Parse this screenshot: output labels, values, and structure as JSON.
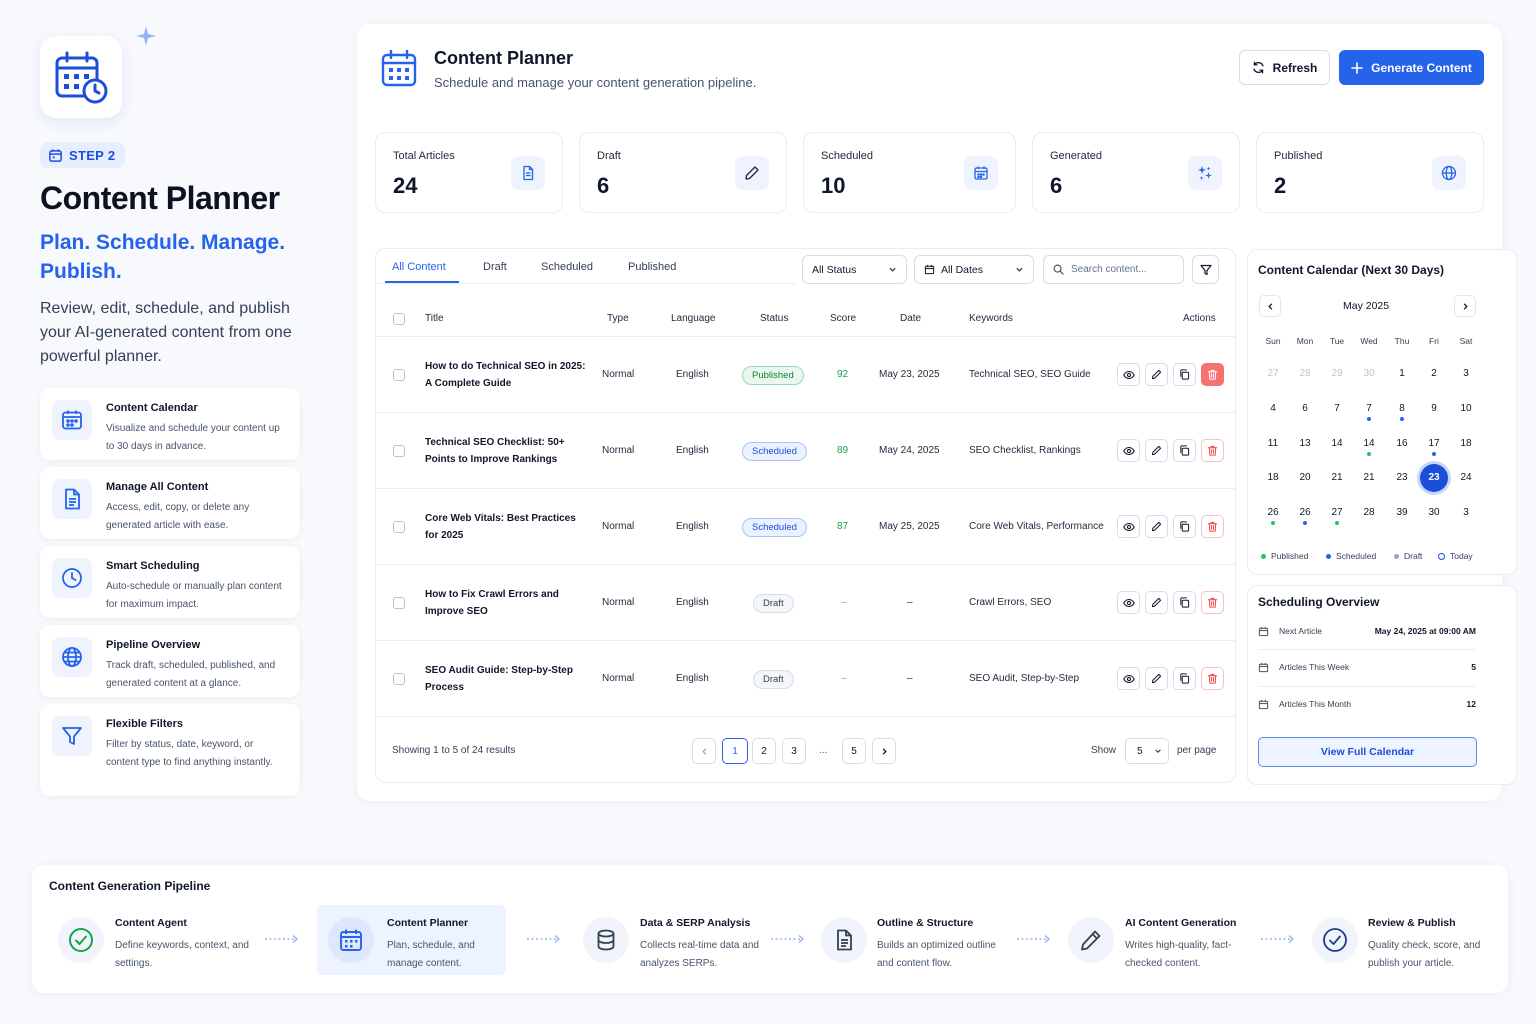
{
  "hero": {
    "step": "STEP 2",
    "title": "Content Planner",
    "tagline": "Plan. Schedule. Manage. Publish.",
    "description": "Review, edit, schedule, and publish your AI-generated content from one powerful planner."
  },
  "features": [
    {
      "title": "Content Calendar",
      "desc": "Visualize and schedule your content up to 30 days in advance.",
      "icon": "calendar-icon"
    },
    {
      "title": "Manage All Content",
      "desc": "Access, edit, copy, or delete any generated article with ease.",
      "icon": "document-icon"
    },
    {
      "title": "Smart Scheduling",
      "desc": "Auto-schedule or manually plan content for maximum impact.",
      "icon": "clock-icon"
    },
    {
      "title": "Pipeline Overview",
      "desc": "Track draft, scheduled, published, and generated content at a glance.",
      "icon": "globe-icon"
    },
    {
      "title": "Flexible Filters",
      "desc": "Filter by status, date, keyword, or content type to find anything instantly.",
      "icon": "filter-icon"
    }
  ],
  "header": {
    "title": "Content Planner",
    "subtitle": "Schedule and manage your content generation pipeline.",
    "refresh_label": "Refresh",
    "generate_label": "Generate Content"
  },
  "stats": [
    {
      "label": "Total Articles",
      "value": "24",
      "icon": "document-icon"
    },
    {
      "label": "Draft",
      "value": "6",
      "icon": "pencil-icon"
    },
    {
      "label": "Scheduled",
      "value": "10",
      "icon": "calendar-icon"
    },
    {
      "label": "Generated",
      "value": "6",
      "icon": "sparkle-icon"
    },
    {
      "label": "Published",
      "value": "2",
      "icon": "globe-icon"
    }
  ],
  "tabs": [
    "All Content",
    "Draft",
    "Scheduled",
    "Published"
  ],
  "filters": {
    "status": "All Status",
    "dates": "All Dates",
    "search_placeholder": "Search content..."
  },
  "table": {
    "columns": [
      "Title",
      "Type",
      "Language",
      "Status",
      "Score",
      "Date",
      "Keywords",
      "Actions"
    ],
    "rows": [
      {
        "title": "How to do Technical SEO in 2025: A Complete Guide",
        "type": "Normal",
        "language": "English",
        "status": "Published",
        "score": "92",
        "date": "May 23, 2025",
        "keywords": "Technical SEO, SEO Guide"
      },
      {
        "title": "Technical SEO Checklist: 50+ Points to Improve Rankings",
        "type": "Normal",
        "language": "English",
        "status": "Scheduled",
        "score": "89",
        "date": "May 24, 2025",
        "keywords": "SEO Checklist, Rankings"
      },
      {
        "title": "Core Web Vitals: Best Practices for 2025",
        "type": "Normal",
        "language": "English",
        "status": "Scheduled",
        "score": "87",
        "date": "May 25, 2025",
        "keywords": "Core Web Vitals, Performance"
      },
      {
        "title": "How to Fix Crawl Errors and Improve SEO",
        "type": "Normal",
        "language": "English",
        "status": "Draft",
        "score": "–",
        "date": "–",
        "keywords": "Crawl Errors, SEO"
      },
      {
        "title": "SEO Audit Guide: Step-by-Step Process",
        "type": "Normal",
        "language": "English",
        "status": "Draft",
        "score": "–",
        "date": "–",
        "keywords": "SEO Audit, Step-by-Step"
      }
    ]
  },
  "pagination": {
    "showing": "Showing 1 to 5 of 24 results",
    "pages": [
      "1",
      "2",
      "3",
      "...",
      "5"
    ],
    "active_page": "1",
    "show_label": "Show",
    "per_page_value": "5",
    "per_page_label": "per page"
  },
  "calendar": {
    "title": "Content Calendar (Next 30 Days)",
    "month": "May 2025",
    "weekdays": [
      "Sun",
      "Mon",
      "Tue",
      "Wed",
      "Thu",
      "Fri",
      "Sat"
    ],
    "weeks": [
      [
        "27",
        "28",
        "29",
        "30",
        "1",
        "2",
        "3"
      ],
      [
        "4",
        "6",
        "7",
        "7",
        "8",
        "9",
        "10"
      ],
      [
        "11",
        "13",
        "14",
        "14",
        "16",
        "17",
        "18"
      ],
      [
        "18",
        "20",
        "21",
        "21",
        "23",
        "23",
        "24"
      ],
      [
        "26",
        "26",
        "27",
        "28",
        "39",
        "30",
        "3"
      ]
    ],
    "legend": [
      "Published",
      "Scheduled",
      "Draft",
      "Today"
    ],
    "colors": {
      "published": "#22c55e",
      "scheduled": "#2563eb",
      "draft": "#94a3b8",
      "today": "#1d4ed8"
    }
  },
  "scheduling": {
    "title": "Scheduling Overview",
    "items": [
      {
        "label": "Next Article",
        "value": "May 24, 2025 at 09:00 AM"
      },
      {
        "label": "Articles This Week",
        "value": "5"
      },
      {
        "label": "Articles This Month",
        "value": "12"
      }
    ],
    "button": "View Full Calendar"
  },
  "pipeline": {
    "title": "Content Generation Pipeline",
    "steps": [
      {
        "name": "Content Agent",
        "desc": "Define keywords, context, and settings.",
        "icon": "check-circle-icon"
      },
      {
        "name": "Content Planner",
        "desc": "Plan, schedule, and manage content.",
        "icon": "calendar-icon"
      },
      {
        "name": "Data & SERP Analysis",
        "desc": "Collects real-time data and analyzes SERPs.",
        "icon": "database-icon"
      },
      {
        "name": "Outline & Structure",
        "desc": "Builds an optimized outline and content flow.",
        "icon": "document-icon"
      },
      {
        "name": "AI Content Generation",
        "desc": "Writes high-quality, fact-checked content.",
        "icon": "pencil-icon"
      },
      {
        "name": "Review & Publish",
        "desc": "Quality check, score, and publish your article.",
        "icon": "check-circle-icon"
      }
    ]
  },
  "theme": {
    "accent": "#2563eb",
    "success": "#16a34a",
    "danger": "#ef4444"
  }
}
